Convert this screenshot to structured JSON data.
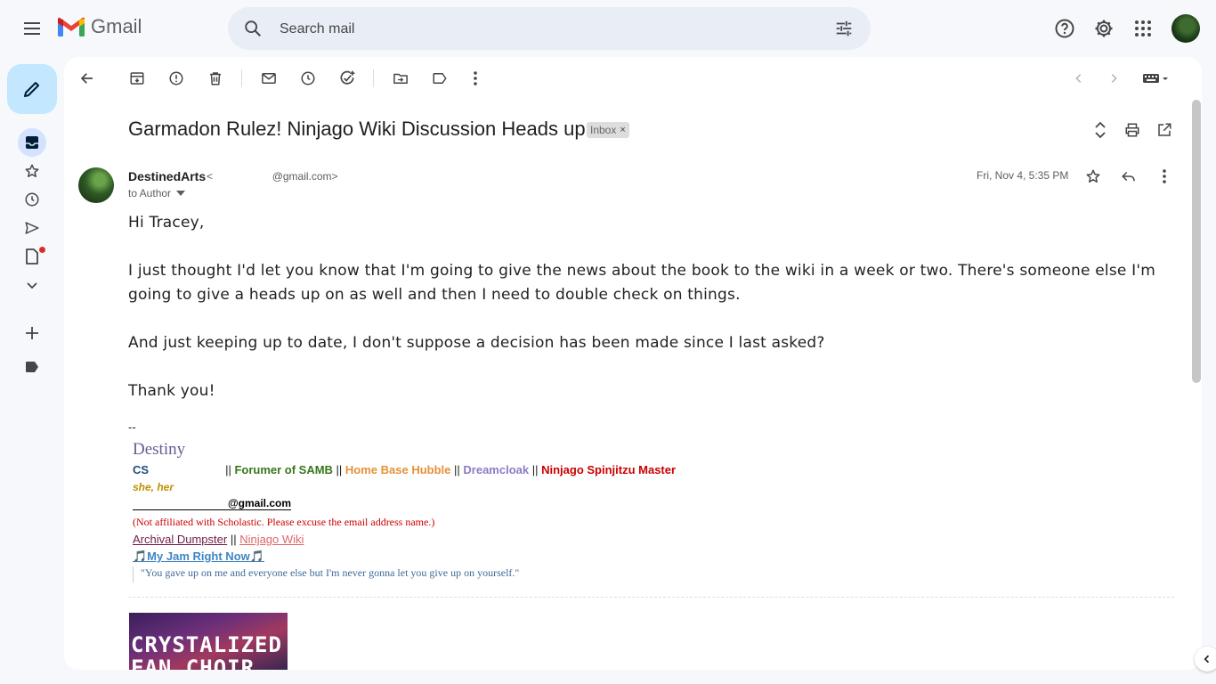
{
  "app": {
    "name": "Gmail"
  },
  "search": {
    "placeholder": "Search mail"
  },
  "email": {
    "subject": "Garmadon Rulez! Ninjago Wiki Discussion Heads up",
    "label_chip": "Inbox",
    "label_chip_remove": "×",
    "sender_name": "DestinedArts",
    "sender_email": "<                    @gmail.com>",
    "to_line": "to Author",
    "date": "Fri, Nov 4, 5:35 PM",
    "body": [
      "Hi Tracey,",
      "I just thought I'd let you know that I'm going to give the news about the book to the wiki in a week or two. There's someone else I'm going to give a heads up on as well and then I need to double check on things.",
      "And just keeping up to date, I don't suppose a decision has been made since I last asked?",
      "Thank you!"
    ],
    "signature": {
      "dash": "--",
      "name": "Destiny",
      "line1": {
        "cs": "CS",
        "sep1": "|| ",
        "forumer": "Forumer of SAMB",
        "sep2": " || ",
        "hubble": "Home Base Hubble",
        "sep3": " || ",
        "dreamcloak": "Dreamcloak",
        "sep4": " || ",
        "ninjago": "Ninjago Spinjitzu Master"
      },
      "pronouns": "she, her",
      "email": "@gmail.com",
      "disclaimer": "(Not affiliated with Scholastic. Please excuse the email address name.)",
      "archival": "Archival Dumpster",
      "links_sep": " || ",
      "wiki": "Ninjago Wiki",
      "jam": "🎵My Jam Right Now🎵",
      "quote": "\"You gave up on me and everyone else but I'm never gonna let you give up on yourself.\""
    },
    "banner": {
      "line1": "CRYSTALIZED",
      "line2": "FAN CHOIR"
    }
  },
  "colors": {
    "background": "#f6f8fc",
    "compose": "#c2e7ff",
    "inbox_active": "#d3e3fd",
    "forumer": "#38761d",
    "hubble": "#e69138",
    "dreamcloak": "#8e7cc3",
    "ninjago": "#cc0000",
    "pronouns": "#bf9000",
    "disclaimer": "#cc0000",
    "wiki": "#e06666",
    "jam": "#3d85c6"
  },
  "icons": {
    "menu": "hamburger-icon",
    "search": "search-icon",
    "tune": "tune-icon",
    "help": "help-icon",
    "settings": "gear-icon",
    "apps": "apps-grid-icon",
    "compose": "pencil-icon",
    "inbox": "inbox-icon",
    "starred": "star-icon",
    "snoozed": "clock-icon",
    "sent": "send-icon",
    "drafts": "draft-icon",
    "more": "chevron-down-icon",
    "new_label": "plus-icon",
    "label": "label-icon"
  }
}
